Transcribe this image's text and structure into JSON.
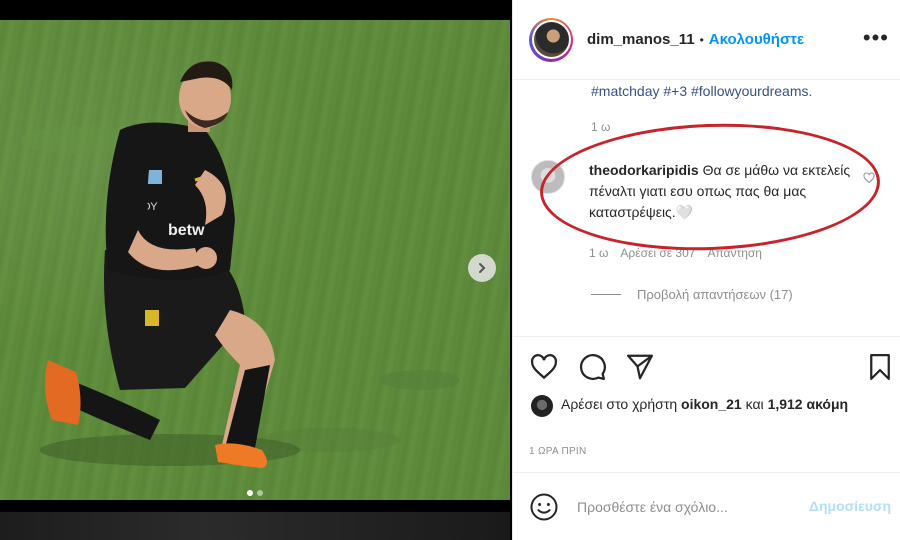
{
  "post": {
    "username": "dim_manos_11",
    "follow_label": "Ακολουθήστε",
    "separator": "•",
    "more_icon": "more-horizontal-icon"
  },
  "caption": {
    "hashtags": "#matchday #+3 #followyourdreams.",
    "time": "1 ω"
  },
  "comment": {
    "user": "theodorkaripidis",
    "text": "Θα σε μάθω να εκτελείς πέναλτι γιατι εσυ οπως πας θα μας καταστρέψεις.🤍",
    "time": "1 ω",
    "likes": "Αρέσει σε 307",
    "reply": "Απάντηση",
    "view_replies": "Προβολή απαντήσεων (17)"
  },
  "likes": {
    "prefix": "Αρέσει στο χρήστη",
    "user": "oikon_21",
    "and": "και",
    "count": "1,912 ακόμη"
  },
  "post_time": "1 ΩΡΑ ΠΡΙΝ",
  "add_comment": {
    "placeholder": "Προσθέστε ένα σχόλιο...",
    "post_label": "Δημοσίευση"
  },
  "colors": {
    "follow": "#0095f6",
    "annotation": "#c8222a",
    "post_disabled": "#b2dffc"
  }
}
